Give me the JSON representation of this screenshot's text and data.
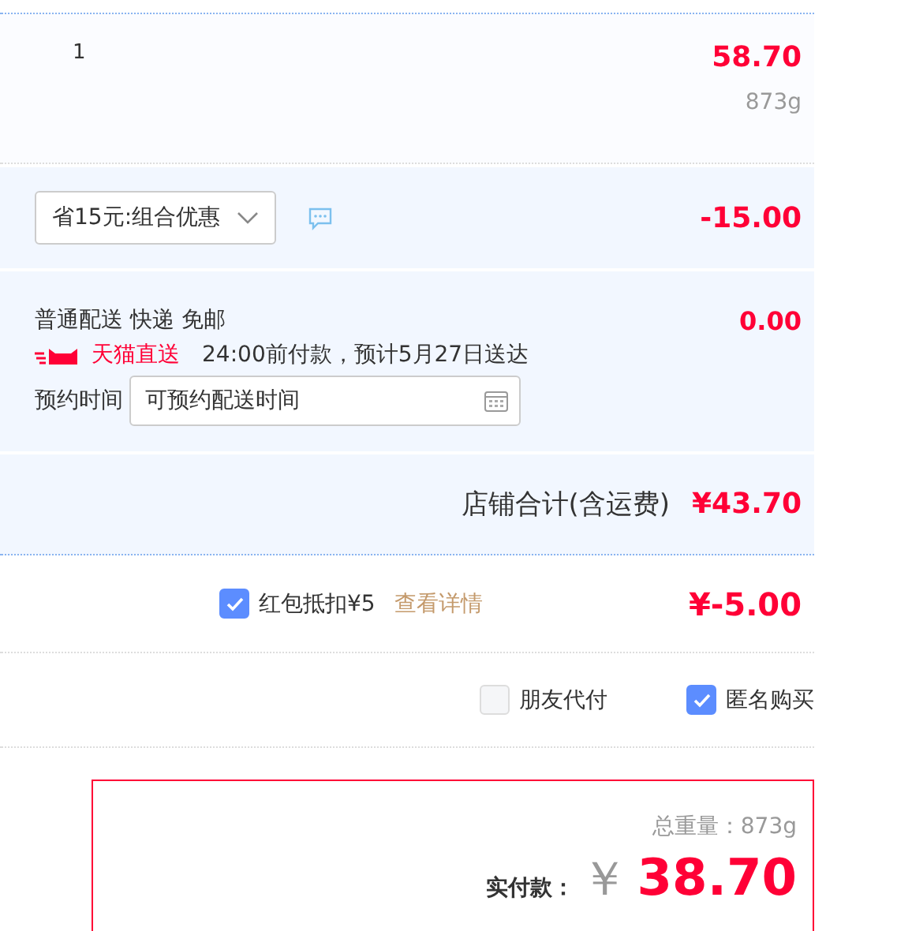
{
  "item": {
    "quantity": "1",
    "price": "58.70",
    "weight": "873g"
  },
  "promotion": {
    "select": "省15元:组合优惠",
    "amount": "-15.00"
  },
  "delivery": {
    "method": "普通配送 快递 免邮",
    "amount": "0.00",
    "badge": "天猫直送",
    "eta": "24:00前付款，预计5月27日送达",
    "time_label": "预约时间",
    "time_field": {
      "placeholder": "可预约配送时间"
    }
  },
  "store_total": {
    "label": "店铺合计(含运费)",
    "amount": "¥43.70"
  },
  "red_packet": {
    "checked": true,
    "label": "红包抵扣¥5",
    "link": "查看详情",
    "amount": "¥-5.00"
  },
  "options": [
    {
      "label": "朋友代付",
      "checked": false
    },
    {
      "label": "匿名购买",
      "checked": true
    }
  ],
  "summary": {
    "weight": "总重量：873g",
    "pay_label": "实付款：",
    "currency": "￥",
    "amount": "38.70"
  }
}
